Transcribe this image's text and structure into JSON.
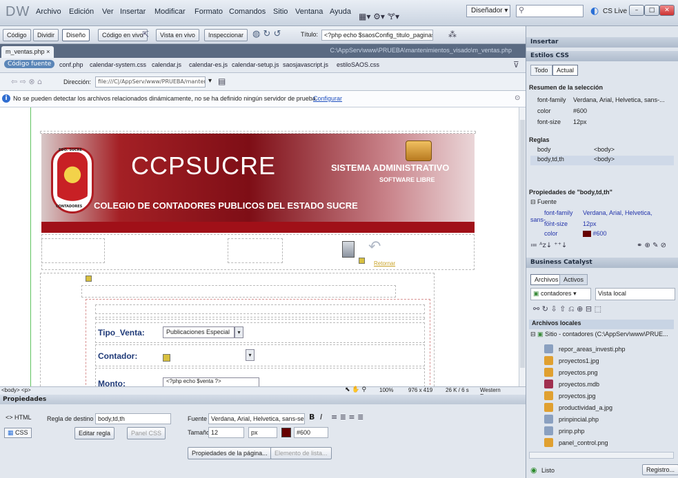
{
  "app": {
    "logo": "DW",
    "menus": [
      "Archivo",
      "Edición",
      "Ver",
      "Insertar",
      "Modificar",
      "Formato",
      "Comandos",
      "Sitio",
      "Ventana",
      "Ayuda"
    ],
    "workspace": "Diseñador",
    "cslive": "CS Live"
  },
  "doc_toolbar": {
    "buttons": [
      "Código",
      "Dividir",
      "Diseño",
      "Código en vivo",
      "Vista en vivo",
      "Inspeccionar"
    ],
    "title_label": "Título:",
    "title_value": "<?php echo $saosConfig_titulo_paginas ?>"
  },
  "tab": {
    "name": "m_ventas.php",
    "path": "C:\\AppServ\\www\\PRUEBA\\mantenimientos_visado\\m_ventas.php"
  },
  "related": {
    "badge": "Código fuente",
    "files": [
      "conf.php",
      "calendar-system.css",
      "calendar.js",
      "calendar-es.js",
      "calendar-setup.js",
      "saosjavascript.js",
      "estiloSAOS.css"
    ]
  },
  "address": {
    "label": "Dirección:",
    "value": "file:///C|/AppServ/www/PRUEBA/mantenimientos_visado/m_ventas.php"
  },
  "info": {
    "message": "No se pueden detectar los archivos relacionados dinámicamente, no se ha definido ningún servidor de prueba.",
    "link": "Configurar"
  },
  "banner": {
    "title": "CCPSUCRE",
    "subtitle": "COLEGIO DE CONTADORES PUBLICOS DEL ESTADO SUCRE",
    "system": "SISTEMA ADMINISTRATIVO",
    "software": "SOFTWARE LIBRE",
    "seal_top": "EDO. SUCRE",
    "seal_bottom": "CONTADORES"
  },
  "form": {
    "retornar": "Retornar",
    "tipo_label": "Tipo_Venta:",
    "tipo_value": "Publicaciones Especial",
    "contador_label": "Contador:",
    "monto_label": "Monto:",
    "monto_value": "<?php echo $venta ?>"
  },
  "status": {
    "tag_path": "<body> <p>",
    "zoom": "100%",
    "size": "976 x 419",
    "weight": "26 K / 6 s",
    "encoding": "Western European"
  },
  "properties": {
    "header": "Propiedades",
    "html_label": "HTML",
    "css_label": "CSS",
    "target_label": "Regla de destino",
    "target_value": "body,td,th",
    "edit_rule": "Editar regla",
    "css_panel": "Panel CSS",
    "font_label": "Fuente",
    "font_value": "Verdana, Arial, Helvetica, sans-se",
    "size_label": "Tamaño",
    "size_value": "12",
    "unit_value": "px",
    "color_value": "#600",
    "page_props": "Propiedades de la página...",
    "list_item": "Elemento de lista..."
  },
  "right": {
    "insert": "Insertar",
    "css_styles": "Estilos CSS",
    "tab_all": "Todo",
    "tab_current": "Actual",
    "summary_title": "Resumen de la selección",
    "summary": [
      {
        "k": "font-family",
        "v": "Verdana, Arial, Helvetica, sans-..."
      },
      {
        "k": "color",
        "v": "#600"
      },
      {
        "k": "font-size",
        "v": "12px"
      }
    ],
    "rules_title": "Reglas",
    "rules": [
      {
        "k": "body",
        "v": "<body>"
      },
      {
        "k": "body,td,th",
        "v": "<body>"
      }
    ],
    "props_title": "Propiedades de \"body,td,th\"",
    "font_group": "Fuente",
    "props": [
      {
        "k": "font-family",
        "v": "Verdana, Arial, Helvetica, sans-..."
      },
      {
        "k": "font-size",
        "v": "12px"
      },
      {
        "k": "color",
        "v": "#600"
      }
    ],
    "business": "Business Catalyst",
    "files_tab": "Archivos",
    "assets_tab": "Activos",
    "site_select": "contadores",
    "view_select": "Vista local",
    "local_files": "Archivos locales",
    "site_root": "Sitio - contadores (C:\\AppServ\\www\\PRUE...",
    "files": [
      {
        "name": "repor_areas_investi.php",
        "color": "#8aa0c0"
      },
      {
        "name": "proyectos1.jpg",
        "color": "#e0a030"
      },
      {
        "name": "proyectos.png",
        "color": "#e0a030"
      },
      {
        "name": "proyectos.mdb",
        "color": "#a03050"
      },
      {
        "name": "proyectos.jpg",
        "color": "#e0a030"
      },
      {
        "name": "productividad_a.jpg",
        "color": "#e0a030"
      },
      {
        "name": "prinpincial.php",
        "color": "#8aa0c0"
      },
      {
        "name": "prinp.php",
        "color": "#8aa0c0"
      },
      {
        "name": "panel_control.png",
        "color": "#e0a030"
      }
    ],
    "status": "Listo",
    "log": "Registro..."
  }
}
